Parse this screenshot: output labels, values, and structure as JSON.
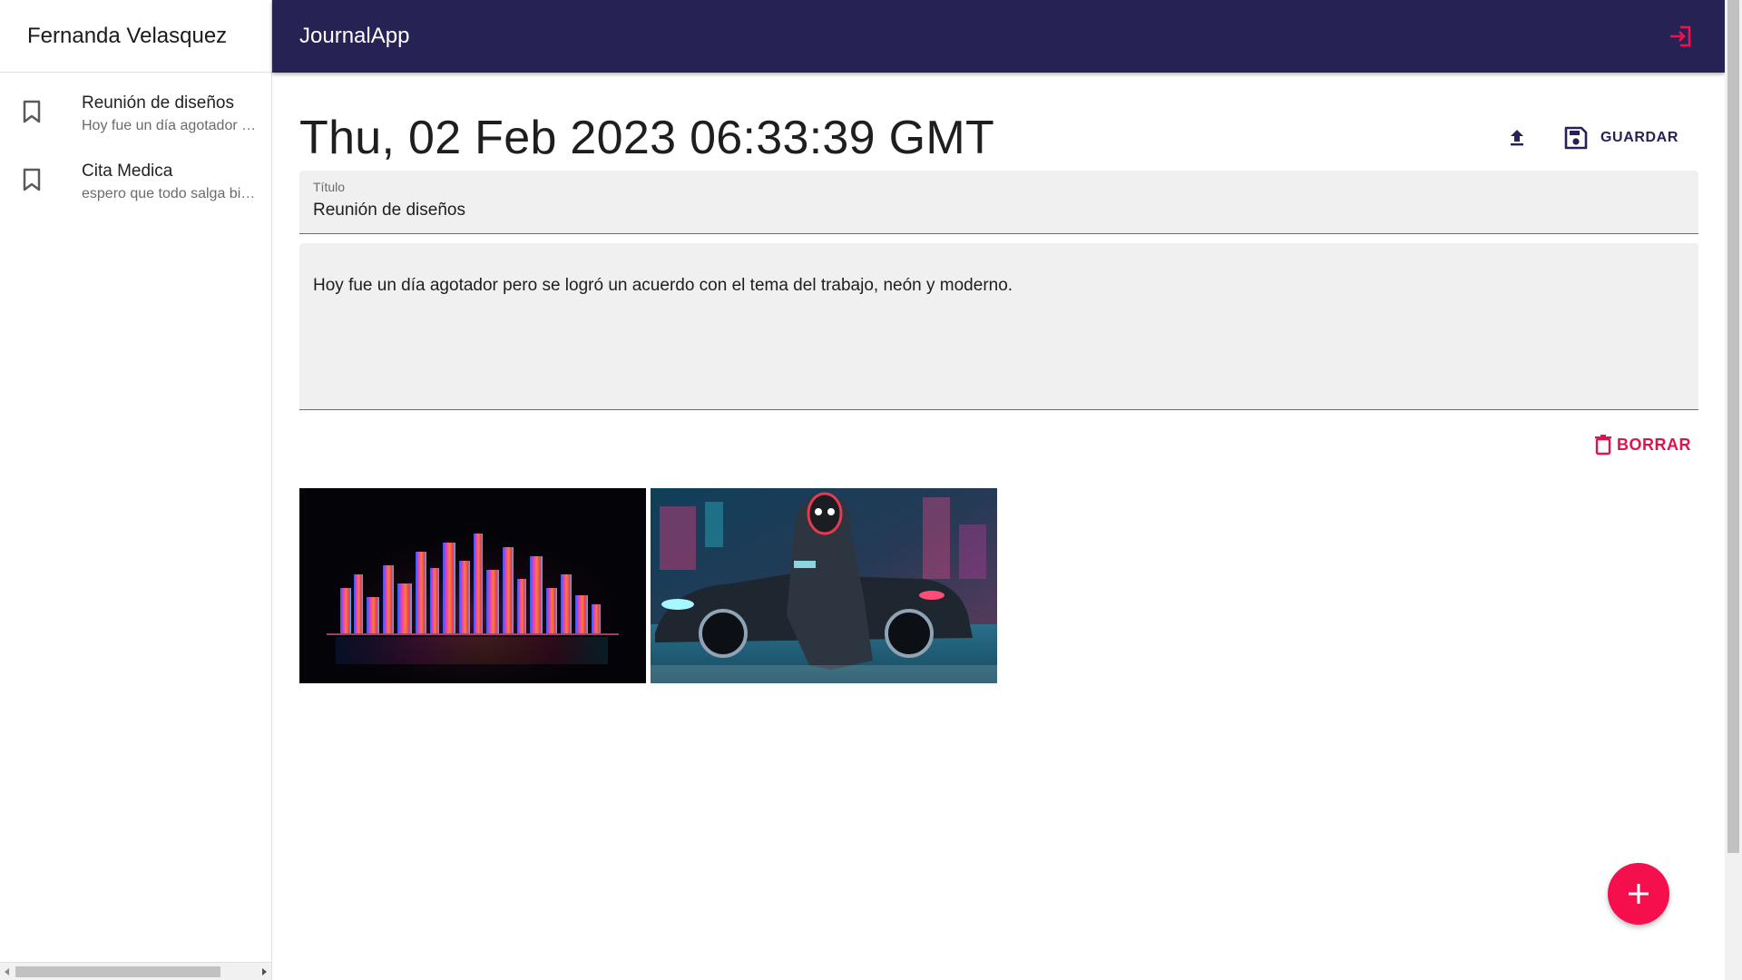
{
  "sidebar": {
    "user_name": "Fernanda Velasquez",
    "notes": [
      {
        "title": "Reunión de diseños",
        "body": "Hoy fue un día agotador pero se logró un acuerdo con el tema del trabajo, neón y moderno."
      },
      {
        "title": "Cita Medica",
        "body": "espero que todo salga bien"
      }
    ]
  },
  "appbar": {
    "title": "JournalApp",
    "logout_icon": "login-icon"
  },
  "note": {
    "date": "Thu, 02 Feb 2023 06:33:39 GMT",
    "save_label": "GUARDAR",
    "title_label": "Título",
    "title_value": "Reunión de diseños",
    "body_value": "Hoy fue un día agotador pero se logró un acuerdo con el tema del trabajo, neón y moderno.",
    "delete_label": "BORRAR",
    "images": [
      "neon-city-skyline",
      "neon-masked-figure-with-car"
    ]
  },
  "colors": {
    "primary": "#262254",
    "accent": "#f50f4d",
    "danger": "#e0134a"
  }
}
